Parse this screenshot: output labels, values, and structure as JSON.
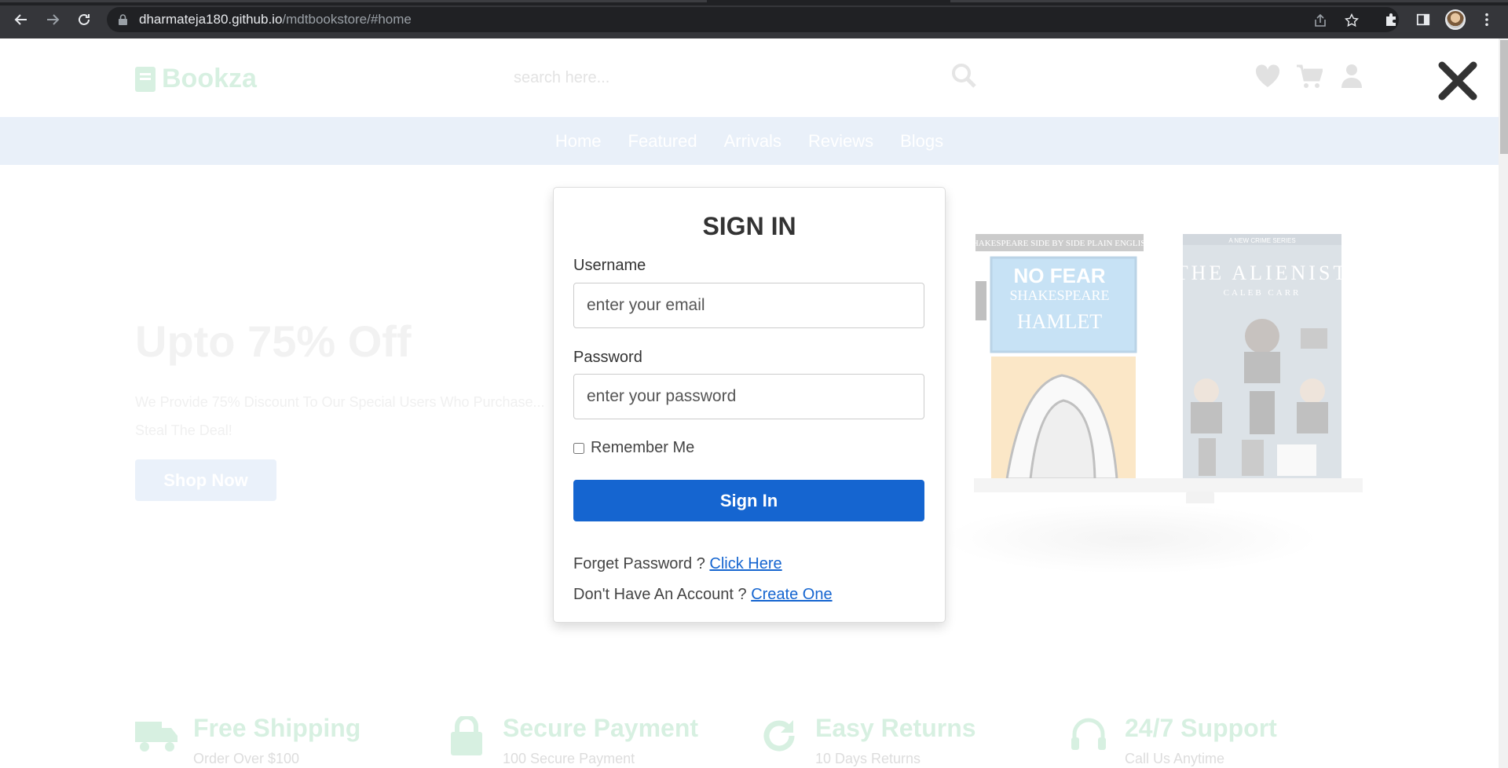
{
  "browser": {
    "url_host": "dharmateja180.github.io",
    "url_path": "/mdtbookstore/#home"
  },
  "header": {
    "logo": "Bookza",
    "search_placeholder": "search here..."
  },
  "nav": {
    "items": [
      "Home",
      "Featured",
      "Arrivals",
      "Reviews",
      "Blogs"
    ]
  },
  "hero": {
    "title": "Upto 75% Off",
    "text": "We Provide 75% Discount To Our Special Users Who Purchase... Steal The Deal!",
    "button": "Shop Now"
  },
  "books": {
    "a_top": "SHAKESPEARE SIDE BY SIDE PLAIN ENGLISH",
    "a_title1": "NO FEAR",
    "a_title2": "SHAKESPEARE",
    "a_title3": "HAMLET",
    "b_top": "A NEW CRIME SERIES",
    "b_title": "THE ALIENIST",
    "b_author": "CALEB CARR"
  },
  "features": [
    {
      "title": "Free Shipping",
      "sub": "Order Over $100"
    },
    {
      "title": "Secure Payment",
      "sub": "100 Secure Payment"
    },
    {
      "title": "Easy Returns",
      "sub": "10 Days Returns"
    },
    {
      "title": "24/7 Support",
      "sub": "Call Us Anytime"
    }
  ],
  "modal": {
    "title": "SIGN IN",
    "username_label": "Username",
    "username_placeholder": "enter your email",
    "password_label": "Password",
    "password_placeholder": "enter your password",
    "remember_label": "Remember Me",
    "submit_label": "Sign In",
    "forget_text": "Forget Password ?",
    "forget_link": "Click Here",
    "account_text": "Don't Have An Account ?",
    "account_link": "Create One"
  },
  "colors": {
    "accent": "#1565d0",
    "brand": "#27ae60",
    "navbar_bg": "#e9f0f9"
  }
}
